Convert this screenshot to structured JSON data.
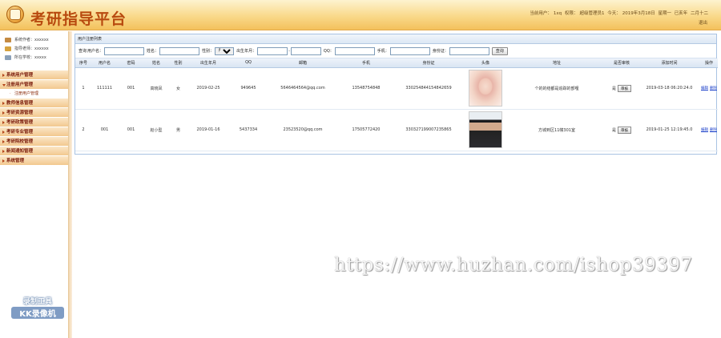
{
  "header": {
    "app_title": "考研指导平台",
    "info": [
      "当前用户：",
      "1xq",
      "权限：",
      "超级管理员1",
      "今天：",
      "2019年3月18日",
      "星期一",
      "已亥年",
      "二月十二"
    ],
    "logout": "退出"
  },
  "sidebar": {
    "user_lines": [
      {
        "icon": "user-icon",
        "text": "系统作者：xxxxxx"
      },
      {
        "icon": "mail-icon",
        "text": "指导老师：xxxxxx"
      },
      {
        "icon": "home-icon",
        "text": "所在学校：xxxxx"
      }
    ],
    "menu": [
      {
        "label": "系统用户管理",
        "open": false
      },
      {
        "label": "注册用户管理",
        "open": true,
        "sub": [
          {
            "label": "注册用户管理"
          }
        ]
      },
      {
        "label": "教师信息管理",
        "open": false
      },
      {
        "label": "考研资源管理",
        "open": false
      },
      {
        "label": "考研政策管理",
        "open": false
      },
      {
        "label": "考研专业管理",
        "open": false
      },
      {
        "label": "考研院校管理",
        "open": false
      },
      {
        "label": "新闻通知管理",
        "open": false
      },
      {
        "label": "系统管理",
        "open": false
      }
    ],
    "tool_badge": {
      "line1": "录制工具",
      "line2": "KK录像机"
    }
  },
  "panel": {
    "title": "用户注册列表",
    "search": {
      "query_label": "查询",
      "username_label": "用户名：",
      "name_label": "姓名：",
      "gender_label": "性别：",
      "gender_selected": "所有",
      "birth_label": "出生年月：",
      "birth_dash": "-",
      "qq_label": "QQ：",
      "phone_label": "手机：",
      "idcard_label": "身份证：",
      "button": "查询"
    },
    "columns": [
      "序号",
      "用户名",
      "密码",
      "姓名",
      "性别",
      "出生年月",
      "QQ",
      "邮箱",
      "手机",
      "身份证",
      "头像",
      "地址",
      "是否审核",
      "添加时间",
      "操作"
    ],
    "rows": [
      {
        "no": "1",
        "username": "111111",
        "password": "001",
        "name": "高晓凤",
        "gender": "女",
        "birth": "2019-02-25",
        "qq": "949645",
        "email": "5646464564@qq.com",
        "phone": "13548754848",
        "idcard": "330254844154842659",
        "avatar": "female",
        "address": "个的的结都是追踪的部哩",
        "audited": "是",
        "audit_btn": "审核",
        "added": "2019-03-18 06:20:24.0",
        "ops": [
          "编辑",
          "删除",
          "详细"
        ]
      },
      {
        "no": "2",
        "username": "001",
        "password": "001",
        "name": "赵小型",
        "gender": "男",
        "birth": "2019-01-16",
        "qq": "5437334",
        "email": "23523520@qq.com",
        "phone": "17505772420",
        "idcard": "330327199007235865",
        "avatar": "male",
        "address": "方城到区11幢301室",
        "audited": "是",
        "audit_btn": "审核",
        "added": "2019-01-25 12:19:45.0",
        "ops": [
          "编辑",
          "删除",
          "详细"
        ]
      }
    ]
  },
  "watermark": "https://www.huzhan.com/ishop39397"
}
